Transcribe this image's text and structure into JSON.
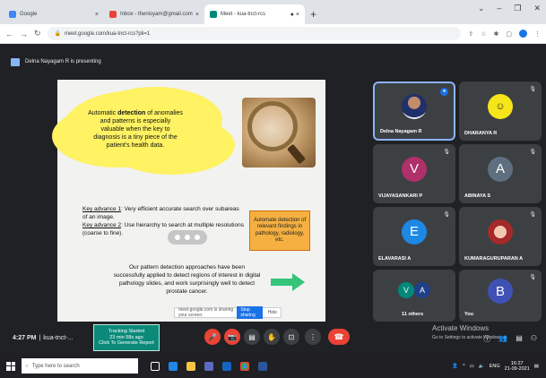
{
  "browser": {
    "tabs": [
      {
        "title": "Google",
        "color": "#4285f4"
      },
      {
        "title": "Inbox - thenisyam@gmail.com",
        "color": "#ea4335"
      },
      {
        "title": "Meet - kua-tnct-rcs",
        "color": "#00897b"
      }
    ],
    "url": "meet.google.com/kua-tnct-rcs?pli=1"
  },
  "meet": {
    "presenting": "Delna Nayagam R is presenting",
    "slide": {
      "cloud_pre": "Automatic ",
      "cloud_bold": "detection",
      "cloud_post": " of anomalies and patterns is especially valuable when the key to diagnosis is a tiny piece of the patient's health data.",
      "key1_label": "Key advance 1",
      "key1_text": ": Very efficient accurate search over subareas of an image.",
      "key2_label": "Key advance 2",
      "key2_text": ": Use hierarchy to search at multiple resolutions (coarse to fine).",
      "orange_box": "Automate detection of relevant findings in pathology, radiology, etc.",
      "bottom_text": "Our pattern detection approaches have been successfully applied to detect regions of interest in digital pathology slides, and work surprisingly well to detect prostate cancer.",
      "share_bar_text": "meet.google.com is sharing your screen.",
      "share_bar_button": "Stop sharing",
      "share_bar_hide": "Hide"
    },
    "participants": [
      {
        "name": "Delna Nayagam R",
        "avatar": "photo"
      },
      {
        "name": "DHARANYA R",
        "avatar": "smiley"
      },
      {
        "name": "VIJAYASANKARI P",
        "initial": "V",
        "color": "#b0306a"
      },
      {
        "name": "ABINAYA S",
        "initial": "A",
        "color": "#5f6f80"
      },
      {
        "name": "ELAVARASI A",
        "initial": "E",
        "color": "#1e88e5"
      },
      {
        "name": "KUMARAGURUPARAN A",
        "avatar": "ganesh"
      },
      {
        "name": "11 others",
        "initials": [
          "V",
          "A"
        ]
      },
      {
        "name": "You",
        "initial": "B",
        "color": "#3f51b5"
      }
    ],
    "time": "4:27 PM",
    "meeting_code": "kua-tnct-...",
    "tracking": {
      "line1": "Tracking Started",
      "line2": "23 min 58s ago",
      "line3": "Click To Generate Report"
    },
    "activate": {
      "title": "Activate Windows",
      "sub": "Go to Settings to activate Windows."
    }
  },
  "taskbar": {
    "search_placeholder": "Type here to search",
    "time": "16:27",
    "date": "21-09-2021",
    "lang": "ENG"
  }
}
